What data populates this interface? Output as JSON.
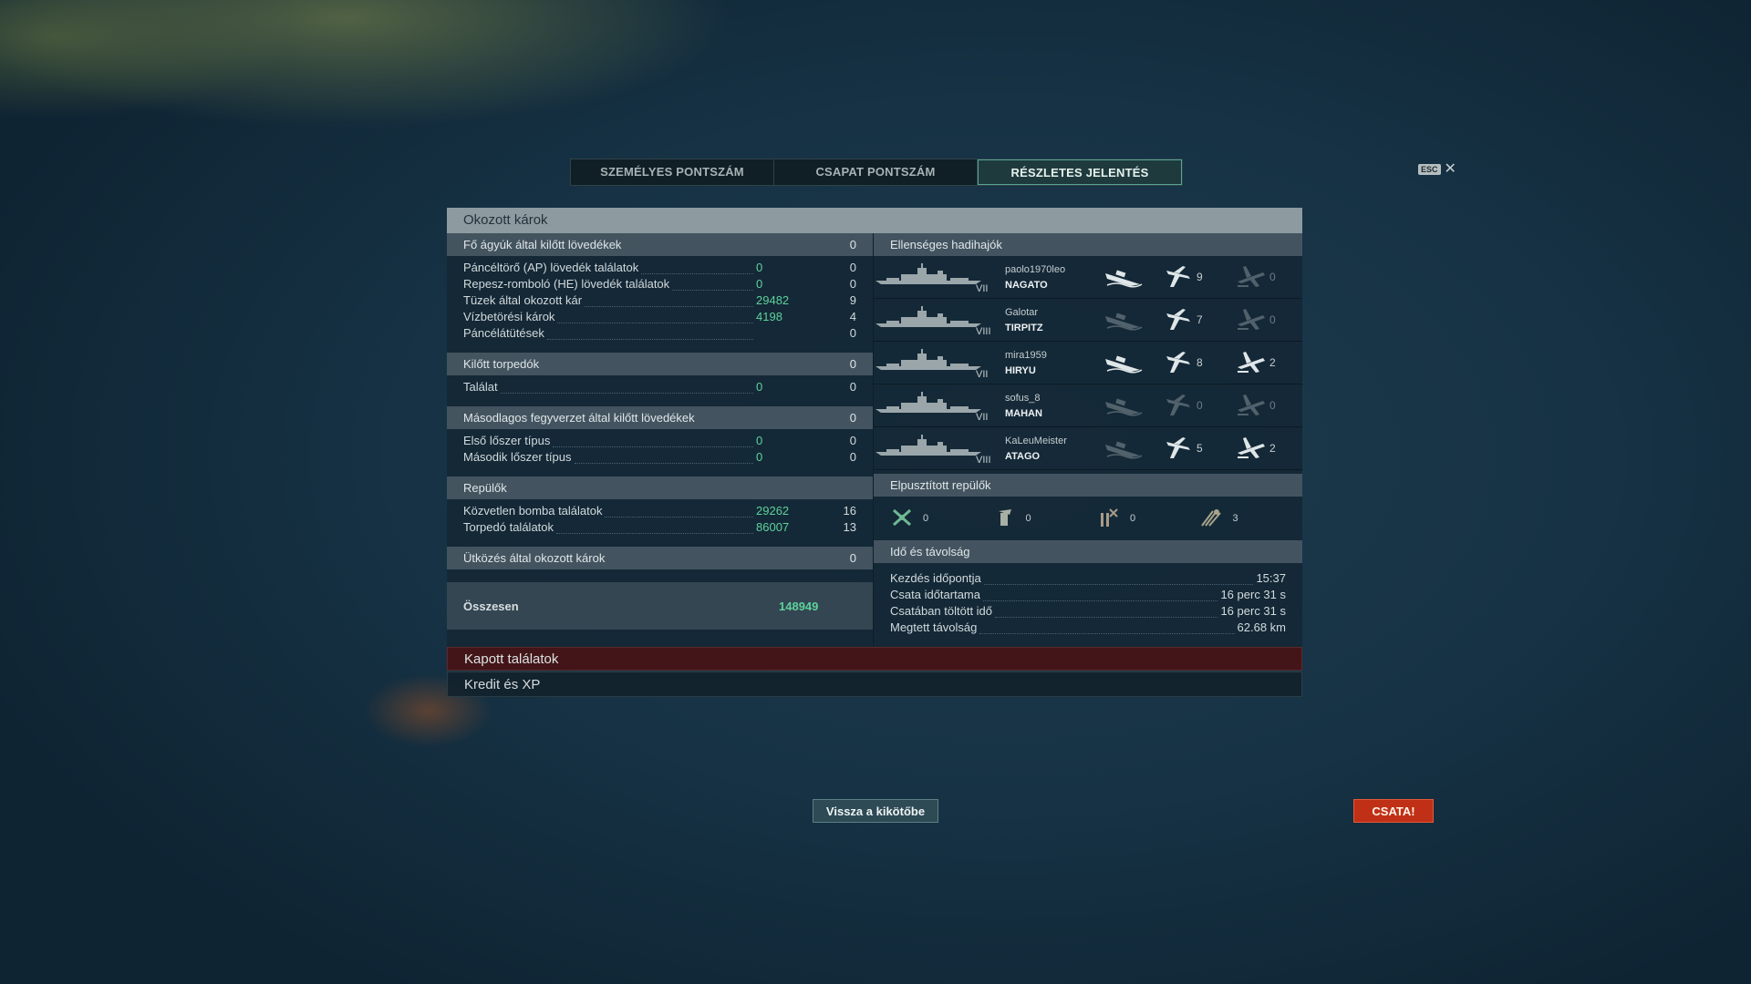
{
  "tabs": [
    "SZEMÉLYES PONTSZÁM",
    "CSAPAT PONTSZÁM",
    "RÉSZLETES JELENTÉS"
  ],
  "active_tab": 2,
  "esc_label": "ESC",
  "panel_title": "Okozott károk",
  "left": {
    "main_guns": {
      "title": "Fő ágyúk által kilőtt lövedékek",
      "count": "0",
      "rows": [
        {
          "label": "Páncéltörő (AP) lövedék találatok",
          "damage": "0",
          "count": "0"
        },
        {
          "label": "Repesz-romboló (HE) lövedék találatok",
          "damage": "0",
          "count": "0"
        },
        {
          "label": "Tüzek által okozott kár",
          "damage": "29482",
          "count": "9"
        },
        {
          "label": "Vízbetörési károk",
          "damage": "4198",
          "count": "4"
        },
        {
          "label": "Páncélátütések",
          "damage": "",
          "count": "0"
        }
      ]
    },
    "torpedoes": {
      "title": "Kilőtt torpedók",
      "count": "0",
      "rows": [
        {
          "label": "Találat",
          "damage": "0",
          "count": "0"
        }
      ]
    },
    "secondary": {
      "title": "Másodlagos fegyverzet által kilőtt lövedékek",
      "count": "0",
      "rows": [
        {
          "label": "Első lőszer típus",
          "damage": "0",
          "count": "0"
        },
        {
          "label": "Második lőszer típus",
          "damage": "0",
          "count": "0"
        }
      ]
    },
    "aircraft": {
      "title": "Repülők",
      "count": "",
      "rows": [
        {
          "label": "Közvetlen bomba találatok",
          "damage": "29262",
          "count": "16"
        },
        {
          "label": "Torpedó találatok",
          "damage": "86007",
          "count": "13"
        }
      ]
    },
    "ramming": {
      "title": "Ütközés által okozott károk",
      "count": "0"
    },
    "total": {
      "label": "Összesen",
      "value": "148949"
    }
  },
  "right": {
    "enemy_title": "Ellenséges hadihajók",
    "ships": [
      {
        "player": "paolo1970leo",
        "ship": "NAGATO",
        "tier": "VII",
        "a": "",
        "b": "9",
        "c": "0",
        "a_on": true,
        "b_on": true,
        "c_on": false
      },
      {
        "player": "Galotar",
        "ship": "TIRPITZ",
        "tier": "VIII",
        "a": "",
        "b": "7",
        "c": "0",
        "a_on": false,
        "b_on": true,
        "c_on": false
      },
      {
        "player": "mira1959",
        "ship": "HIRYU",
        "tier": "VII",
        "a": "",
        "b": "8",
        "c": "2",
        "a_on": true,
        "b_on": true,
        "c_on": true
      },
      {
        "player": "sofus_8",
        "ship": "MAHAN",
        "tier": "VII",
        "a": "",
        "b": "0",
        "c": "0",
        "a_on": false,
        "b_on": false,
        "c_on": false
      },
      {
        "player": "KaLeuMeister",
        "ship": "ATAGO",
        "tier": "VIII",
        "a": "",
        "b": "5",
        "c": "2",
        "a_on": false,
        "b_on": true,
        "c_on": true
      }
    ],
    "planes_title": "Elpusztított repülők",
    "planes": [
      {
        "icon": "fighter-icon",
        "value": "0"
      },
      {
        "icon": "bomber-icon",
        "value": "0"
      },
      {
        "icon": "torpedo-bomber-icon",
        "value": "0"
      },
      {
        "icon": "scout-plane-icon",
        "value": "3"
      }
    ],
    "time_title": "Idő és távolság",
    "time_rows": [
      {
        "label": "Kezdés időpontja",
        "value": "15:37"
      },
      {
        "label": "Csata időtartama",
        "value": "16 perc 31 s"
      },
      {
        "label": "Csatában töltött idő",
        "value": "16 perc 31 s"
      },
      {
        "label": "Megtett távolság",
        "value": "62.68 km"
      }
    ]
  },
  "received_hits": "Kapott találatok",
  "credit_xp": "Kredit és XP",
  "back_button": "Vissza a kikötőbe",
  "battle_button": "CSATA!"
}
